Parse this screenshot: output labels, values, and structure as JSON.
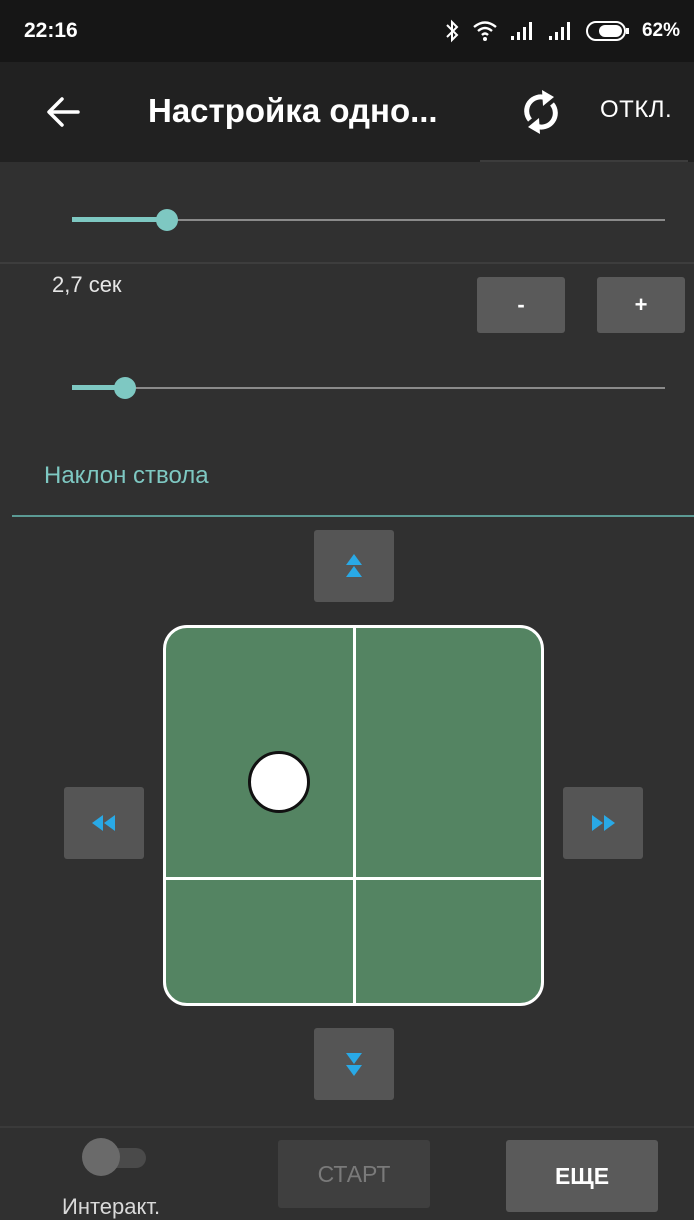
{
  "status_bar": {
    "time": "22:16",
    "battery_percent": "62%",
    "icons": [
      "bluetooth-icon",
      "wifi-icon",
      "signal-icon",
      "signal-icon",
      "battery-icon"
    ]
  },
  "toolbar": {
    "title": "Настройка одно...",
    "back_icon": "arrow-left-icon",
    "refresh_icon": "refresh-icon",
    "disconnect_label": "ОТКЛ."
  },
  "controls": {
    "slider_top": {
      "value_fraction": 0.16
    },
    "duration_text": "2,7 сек",
    "minus_label": "-",
    "plus_label": "+",
    "slider_duration": {
      "value_fraction": 0.09
    },
    "section_title": "Наклон ствола"
  },
  "joystick": {
    "up_icon": "chevron-double-up-icon",
    "down_icon": "chevron-double-down-icon",
    "left_icon": "chevron-double-left-icon",
    "right_icon": "chevron-double-right-icon",
    "accent_color": "#29a9e6",
    "pad_color": "#548462"
  },
  "bottom_bar": {
    "toggle_label": "Интеракт.",
    "toggle_on": false,
    "start_label": "СТАРТ",
    "more_label": "ЕЩЕ"
  },
  "colors": {
    "accent": "#7ec8c2",
    "background": "#303030"
  }
}
